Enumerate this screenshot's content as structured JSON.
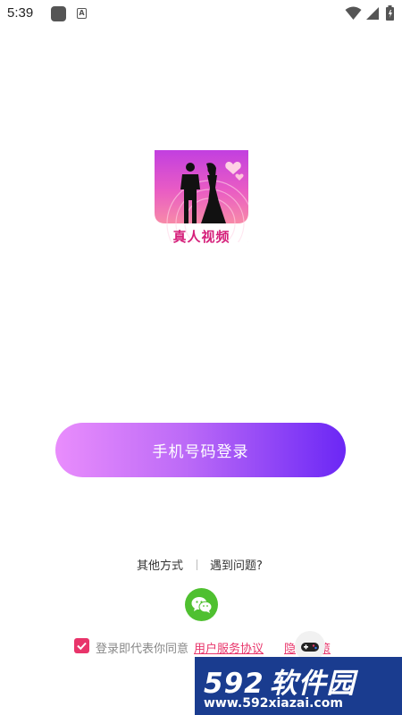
{
  "status_bar": {
    "time": "5:39",
    "icons": [
      "notification-square-icon",
      "a-notification-icon",
      "wifi-icon",
      "signal-icon",
      "battery-icon"
    ],
    "a_letter": "A"
  },
  "app": {
    "logo_title": "真人视频"
  },
  "login": {
    "phone_button_label": "手机号码登录",
    "other_methods_label": "其他方式",
    "help_label": "遇到问题?",
    "wechat_icon": "wechat-icon"
  },
  "agreement": {
    "checked": true,
    "prefix_text": "登录即代表你同意",
    "user_agreement_link": "用户服务协议",
    "privacy_link_visible": "隐",
    "privacy_link_tail": "策"
  },
  "watermark": {
    "brand_number": "592",
    "brand_text": "软件园",
    "url": "www.592xiazai.com"
  },
  "colors": {
    "accent": "#e8346a",
    "button_gradient_start": "#e98dfc",
    "button_gradient_end": "#6b27f5",
    "wechat_green": "#4fc030",
    "logo_title": "#d51f7a"
  }
}
